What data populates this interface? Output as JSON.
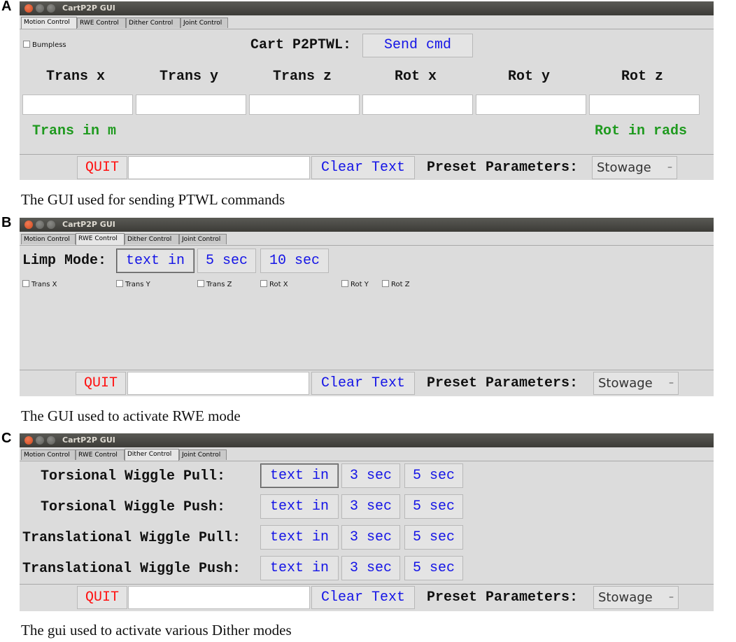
{
  "window_title": "CartP2P GUI",
  "tabs": [
    "Motion Control",
    "RWE Control",
    "Dither Control",
    "Joint Control"
  ],
  "bottom_bar": {
    "quit_label": "QUIT",
    "clear_label": "Clear Text",
    "preset_label": "Preset Parameters:",
    "preset_value": "Stowage",
    "text_value": ""
  },
  "panels": [
    {
      "letter": "A",
      "caption": "The GUI used for sending PTWL commands",
      "bumpless_label": "Bumpless",
      "cmd_label": "Cart P2PTWL:",
      "send_label": "Send cmd",
      "fields": [
        "Trans x",
        "Trans y",
        "Trans z",
        "Rot x",
        "Rot y",
        "Rot z"
      ],
      "trans_unit": "Trans in m",
      "rot_unit": "Rot in rads"
    },
    {
      "letter": "B",
      "caption": "The GUI used to activate RWE mode",
      "limp_label": "Limp Mode:",
      "limp_buttons": [
        "text in",
        "5 sec",
        "10 sec"
      ],
      "checkboxes": [
        "Trans X",
        "Trans Y",
        "Trans Z",
        "Rot X",
        "Rot Y",
        "Rot Z"
      ]
    },
    {
      "letter": "C",
      "caption": "The gui used to activate various Dither modes",
      "rows": [
        {
          "label": "Torsional Wiggle Pull:",
          "buttons": [
            "text in",
            "3 sec",
            "5 sec"
          ]
        },
        {
          "label": "Torsional Wiggle Push:",
          "buttons": [
            "text in",
            "3 sec",
            "5 sec"
          ]
        },
        {
          "label": "Translational Wiggle Pull:",
          "buttons": [
            "text in",
            "3 sec",
            "5 sec"
          ]
        },
        {
          "label": "Translational Wiggle Push:",
          "buttons": [
            "text in",
            "3 sec",
            "5 sec"
          ]
        }
      ]
    }
  ],
  "colors": {
    "window_bg": "#dcdcdc",
    "button_text": "#1414e6",
    "quit_text": "#ff1010",
    "unit_text": "#1f9a1f",
    "titlebar": "#3c3b37"
  }
}
